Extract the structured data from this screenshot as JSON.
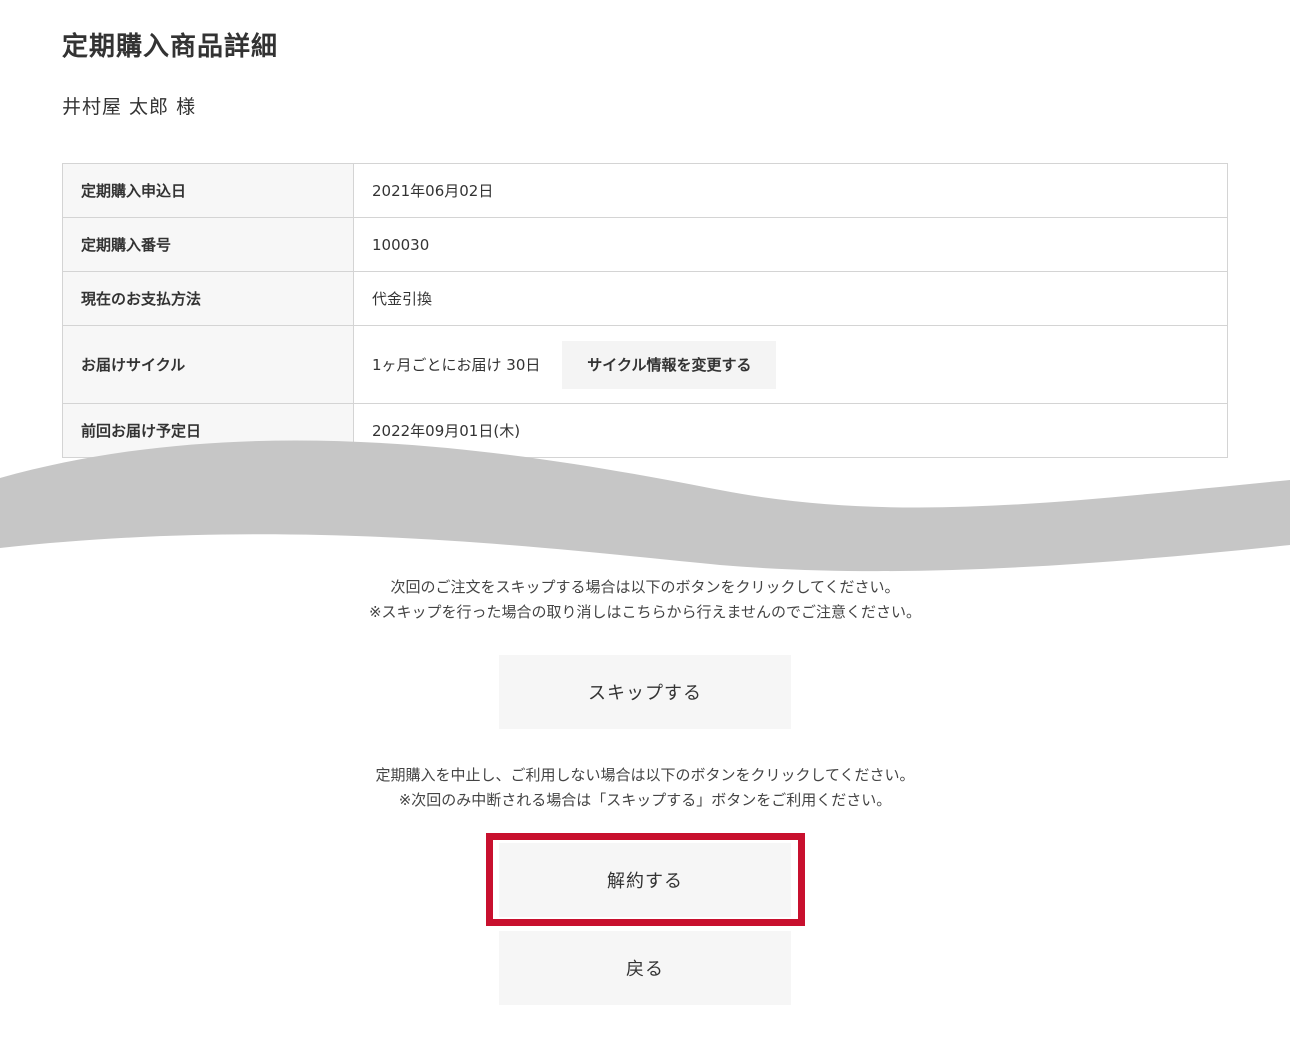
{
  "page": {
    "title": "定期購入商品詳細",
    "customer_name": "井村屋 太郎 様"
  },
  "details": {
    "rows": [
      {
        "label": "定期購入申込日",
        "value": "2021年06月02日"
      },
      {
        "label": "定期購入番号",
        "value": "100030"
      },
      {
        "label": "現在のお支払方法",
        "value": "代金引換"
      },
      {
        "label": "お届けサイクル",
        "value": "1ヶ月ごとにお届け 30日",
        "button": "サイクル情報を変更する"
      },
      {
        "label": "前回お届け予定日",
        "value": "2022年09月01日(木)"
      }
    ]
  },
  "skip_section": {
    "notice_line1": "次回のご注文をスキップする場合は以下のボタンをクリックしてください。",
    "notice_line2": "※スキップを行った場合の取り消しはこちらから行えませんのでご注意ください。",
    "button_label": "スキップする"
  },
  "cancel_section": {
    "notice_line1": "定期購入を中止し、ご利用しない場合は以下のボタンをクリックしてください。",
    "notice_line2": "※次回のみ中断される場合は「スキップする」ボタンをご利用ください。",
    "button_label": "解約する"
  },
  "back_button": {
    "label": "戻る"
  },
  "colors": {
    "highlight": "#c8102e",
    "wave": "#c6c6c6",
    "header_cell_bg": "#f7f7f7",
    "button_bg": "#f6f6f6"
  }
}
